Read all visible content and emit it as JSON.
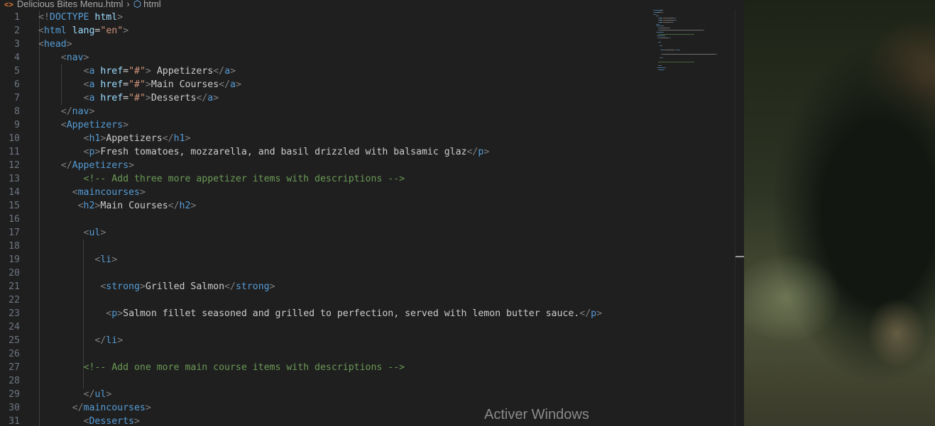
{
  "breadcrumb": {
    "file_name": "Delicious Bites Menu.html",
    "symbol": "html"
  },
  "code_lines": [
    {
      "n": "1",
      "segs": [
        [
          "ang",
          "<!"
        ],
        [
          "doct",
          "DOCTYPE "
        ],
        [
          "attr",
          "html"
        ],
        [
          "ang",
          ">"
        ]
      ]
    },
    {
      "n": "2",
      "segs": [
        [
          "ang",
          "<"
        ],
        [
          "tag",
          "html "
        ],
        [
          "attr",
          "lang"
        ],
        [
          "txt",
          "="
        ],
        [
          "str",
          "\"en\""
        ],
        [
          "ang",
          ">"
        ]
      ]
    },
    {
      "n": "3",
      "segs": [
        [
          "ang",
          "<"
        ],
        [
          "tag",
          "head"
        ],
        [
          "ang",
          ">"
        ]
      ]
    },
    {
      "n": "4",
      "segs": [
        [
          "txt",
          "    "
        ],
        [
          "ang",
          "<"
        ],
        [
          "tag",
          "nav"
        ],
        [
          "ang",
          ">"
        ]
      ]
    },
    {
      "n": "5",
      "segs": [
        [
          "txt",
          "        "
        ],
        [
          "ang",
          "<"
        ],
        [
          "tag",
          "a "
        ],
        [
          "attr",
          "href"
        ],
        [
          "txt",
          "="
        ],
        [
          "str",
          "\"#\""
        ],
        [
          "ang",
          ">"
        ],
        [
          "txt",
          " Appetizers"
        ],
        [
          "ang",
          "</"
        ],
        [
          "tag",
          "a"
        ],
        [
          "ang",
          ">"
        ]
      ]
    },
    {
      "n": "6",
      "segs": [
        [
          "txt",
          "        "
        ],
        [
          "ang",
          "<"
        ],
        [
          "tag",
          "a "
        ],
        [
          "attr",
          "href"
        ],
        [
          "txt",
          "="
        ],
        [
          "str",
          "\"#\""
        ],
        [
          "ang",
          ">"
        ],
        [
          "txt",
          "Main Courses"
        ],
        [
          "ang",
          "</"
        ],
        [
          "tag",
          "a"
        ],
        [
          "ang",
          ">"
        ]
      ]
    },
    {
      "n": "7",
      "segs": [
        [
          "txt",
          "        "
        ],
        [
          "ang",
          "<"
        ],
        [
          "tag",
          "a "
        ],
        [
          "attr",
          "href"
        ],
        [
          "txt",
          "="
        ],
        [
          "str",
          "\"#\""
        ],
        [
          "ang",
          ">"
        ],
        [
          "txt",
          "Desserts"
        ],
        [
          "ang",
          "</"
        ],
        [
          "tag",
          "a"
        ],
        [
          "ang",
          ">"
        ]
      ]
    },
    {
      "n": "8",
      "segs": [
        [
          "txt",
          "    "
        ],
        [
          "ang",
          "</"
        ],
        [
          "tag",
          "nav"
        ],
        [
          "ang",
          ">"
        ]
      ]
    },
    {
      "n": "9",
      "segs": [
        [
          "txt",
          "    "
        ],
        [
          "ang",
          "<"
        ],
        [
          "tag",
          "Appetizers"
        ],
        [
          "ang",
          ">"
        ]
      ]
    },
    {
      "n": "10",
      "segs": [
        [
          "txt",
          "        "
        ],
        [
          "ang",
          "<"
        ],
        [
          "tag",
          "h1"
        ],
        [
          "ang",
          ">"
        ],
        [
          "txt",
          "Appetizers"
        ],
        [
          "ang",
          "</"
        ],
        [
          "tag",
          "h1"
        ],
        [
          "ang",
          ">"
        ]
      ]
    },
    {
      "n": "11",
      "segs": [
        [
          "txt",
          "        "
        ],
        [
          "ang",
          "<"
        ],
        [
          "tag",
          "p"
        ],
        [
          "ang",
          ">"
        ],
        [
          "txt",
          "Fresh tomatoes, mozzarella, and basil drizzled with balsamic glaz"
        ],
        [
          "ang",
          "</"
        ],
        [
          "tag",
          "p"
        ],
        [
          "ang",
          ">"
        ]
      ]
    },
    {
      "n": "12",
      "segs": [
        [
          "txt",
          "    "
        ],
        [
          "ang",
          "</"
        ],
        [
          "tag",
          "Appetizers"
        ],
        [
          "ang",
          ">"
        ]
      ]
    },
    {
      "n": "13",
      "segs": [
        [
          "txt",
          "        "
        ],
        [
          "cmt",
          "<!-- Add three more appetizer items with descriptions -->"
        ]
      ]
    },
    {
      "n": "14",
      "segs": [
        [
          "txt",
          "      "
        ],
        [
          "ang",
          "<"
        ],
        [
          "tag",
          "maincourses"
        ],
        [
          "ang",
          ">"
        ]
      ]
    },
    {
      "n": "15",
      "segs": [
        [
          "txt",
          "       "
        ],
        [
          "ang",
          "<"
        ],
        [
          "tag",
          "h2"
        ],
        [
          "ang",
          ">"
        ],
        [
          "txt",
          "Main Courses"
        ],
        [
          "ang",
          "</"
        ],
        [
          "tag",
          "h2"
        ],
        [
          "ang",
          ">"
        ]
      ]
    },
    {
      "n": "16",
      "segs": []
    },
    {
      "n": "17",
      "segs": [
        [
          "txt",
          "        "
        ],
        [
          "ang",
          "<"
        ],
        [
          "tag",
          "ul"
        ],
        [
          "ang",
          ">"
        ]
      ]
    },
    {
      "n": "18",
      "segs": []
    },
    {
      "n": "19",
      "segs": [
        [
          "txt",
          "          "
        ],
        [
          "ang",
          "<"
        ],
        [
          "tag",
          "li"
        ],
        [
          "ang",
          ">"
        ]
      ]
    },
    {
      "n": "20",
      "segs": []
    },
    {
      "n": "21",
      "segs": [
        [
          "txt",
          "           "
        ],
        [
          "ang",
          "<"
        ],
        [
          "tag",
          "strong"
        ],
        [
          "ang",
          ">"
        ],
        [
          "txt",
          "Grilled Salmon"
        ],
        [
          "ang",
          "</"
        ],
        [
          "tag",
          "strong"
        ],
        [
          "ang",
          ">"
        ]
      ]
    },
    {
      "n": "22",
      "segs": []
    },
    {
      "n": "23",
      "segs": [
        [
          "txt",
          "            "
        ],
        [
          "ang",
          "<"
        ],
        [
          "tag",
          "p"
        ],
        [
          "ang",
          ">"
        ],
        [
          "txt",
          "Salmon fillet seasoned and grilled to perfection, served with lemon butter sauce."
        ],
        [
          "ang",
          "</"
        ],
        [
          "tag",
          "p"
        ],
        [
          "ang",
          ">"
        ]
      ]
    },
    {
      "n": "24",
      "segs": []
    },
    {
      "n": "25",
      "segs": [
        [
          "txt",
          "          "
        ],
        [
          "ang",
          "</"
        ],
        [
          "tag",
          "li"
        ],
        [
          "ang",
          ">"
        ]
      ]
    },
    {
      "n": "26",
      "segs": []
    },
    {
      "n": "27",
      "segs": [
        [
          "txt",
          "        "
        ],
        [
          "cmt",
          "<!-- Add one more main course items with descriptions -->"
        ]
      ]
    },
    {
      "n": "28",
      "segs": []
    },
    {
      "n": "29",
      "segs": [
        [
          "txt",
          "        "
        ],
        [
          "ang",
          "</"
        ],
        [
          "tag",
          "ul"
        ],
        [
          "ang",
          ">"
        ]
      ]
    },
    {
      "n": "30",
      "segs": [
        [
          "txt",
          "      "
        ],
        [
          "ang",
          "</"
        ],
        [
          "tag",
          "maincourses"
        ],
        [
          "ang",
          ">"
        ]
      ]
    },
    {
      "n": "31",
      "segs": [
        [
          "txt",
          "        "
        ],
        [
          "ang",
          "<"
        ],
        [
          "tag",
          "Desserts"
        ],
        [
          "ang",
          ">"
        ]
      ]
    }
  ],
  "colors": {
    "background": "#1f1f1f",
    "line_number": "#6e7681",
    "tag": "#569cd6",
    "bracket": "#808080",
    "attribute": "#9cdcfe",
    "string": "#ce9178",
    "comment": "#6a9955",
    "text": "#cccccc"
  },
  "icons": {
    "file": "html-file-icon",
    "symbol": "cube-icon"
  },
  "watermark": "Activer Windows"
}
